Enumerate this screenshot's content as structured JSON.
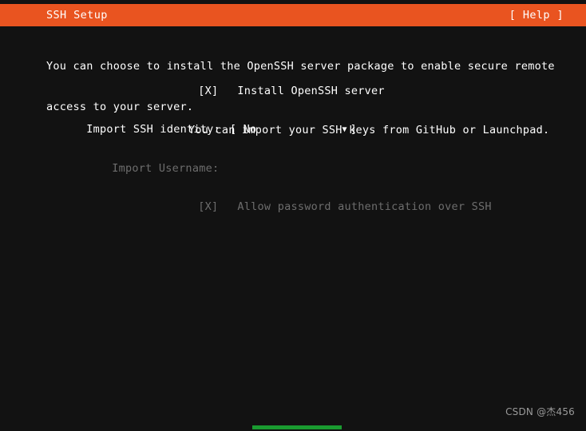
{
  "header": {
    "title": "SSH Setup",
    "help_label": "[ Help ]",
    "background_color": "#e95420",
    "text_color": "#ffffff"
  },
  "screen": {
    "background_color": "#121212",
    "text_color": "#ffffff",
    "disabled_text_color": "#6d6d6d"
  },
  "main": {
    "intro_line_1": "You can choose to install the OpenSSH server package to enable secure remote",
    "intro_line_2": "access to your server.",
    "install_ssh": {
      "checkbox": "[X]",
      "label": "Install OpenSSH server",
      "checked": true
    },
    "import_identity": {
      "label": "Import SSH identity:",
      "bracket_open": "[",
      "value": "No",
      "arrow": "▼",
      "bracket_close": "]",
      "hint": "You can import your SSH keys from GitHub or Launchpad."
    },
    "import_username": {
      "label": "Import Username:",
      "disabled": true
    },
    "password_auth": {
      "checkbox": "[X]",
      "label": "Allow password authentication over SSH",
      "checked": true,
      "disabled": true
    }
  },
  "footer": {
    "watermark": "CSDN @杰456",
    "progress_color": "#1a9b30"
  }
}
